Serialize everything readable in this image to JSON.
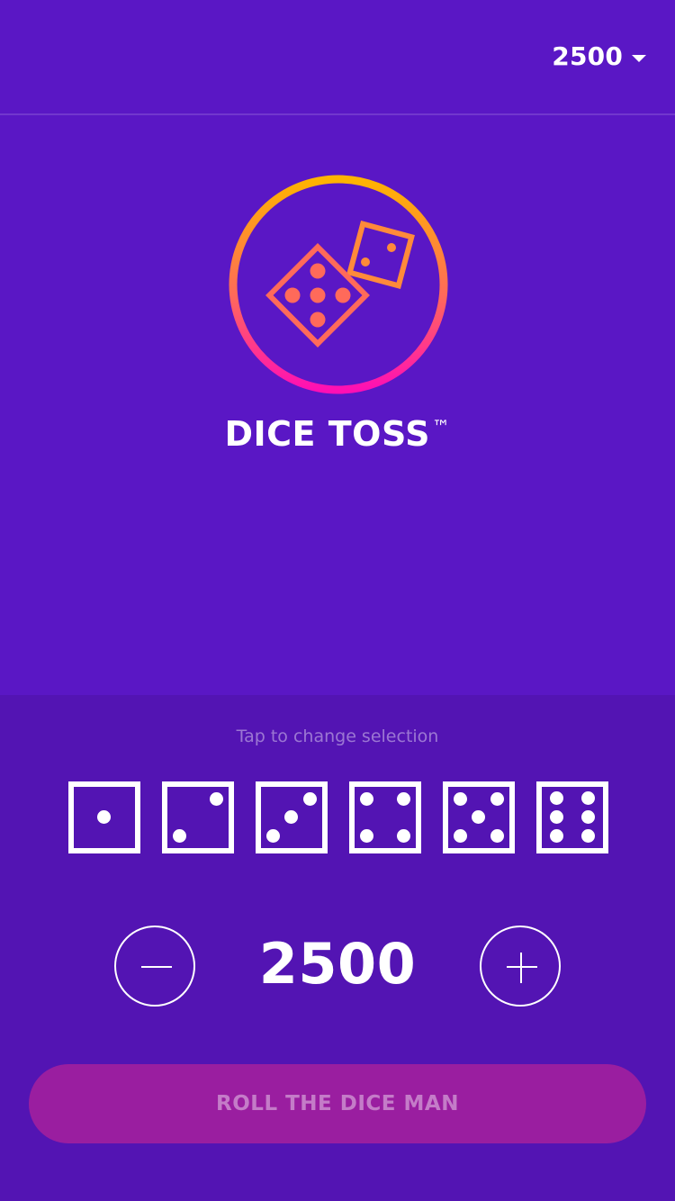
{
  "header": {
    "balance": "2500",
    "caret_icon": "caret-down-icon"
  },
  "hero": {
    "logo_icon": "dice-logo-icon",
    "title": "DICE TOSS",
    "trademark": "™"
  },
  "selection": {
    "hint": "Tap to change selection",
    "dice": [
      {
        "face": 1,
        "icon": "die-one-icon"
      },
      {
        "face": 2,
        "icon": "die-two-icon"
      },
      {
        "face": 3,
        "icon": "die-three-icon"
      },
      {
        "face": 4,
        "icon": "die-four-icon"
      },
      {
        "face": 5,
        "icon": "die-five-icon"
      },
      {
        "face": 6,
        "icon": "die-six-icon"
      }
    ]
  },
  "bet": {
    "amount": "2500",
    "decrease_icon": "minus-icon",
    "increase_icon": "plus-icon"
  },
  "actions": {
    "roll_label": "ROLL THE DICE MAN"
  },
  "colors": {
    "background": "#5a17c5",
    "panel": "#5314b3",
    "button": "#9a1ea0",
    "logo_gradient_top": "#ffb400",
    "logo_gradient_bottom": "#ff0fb4"
  }
}
